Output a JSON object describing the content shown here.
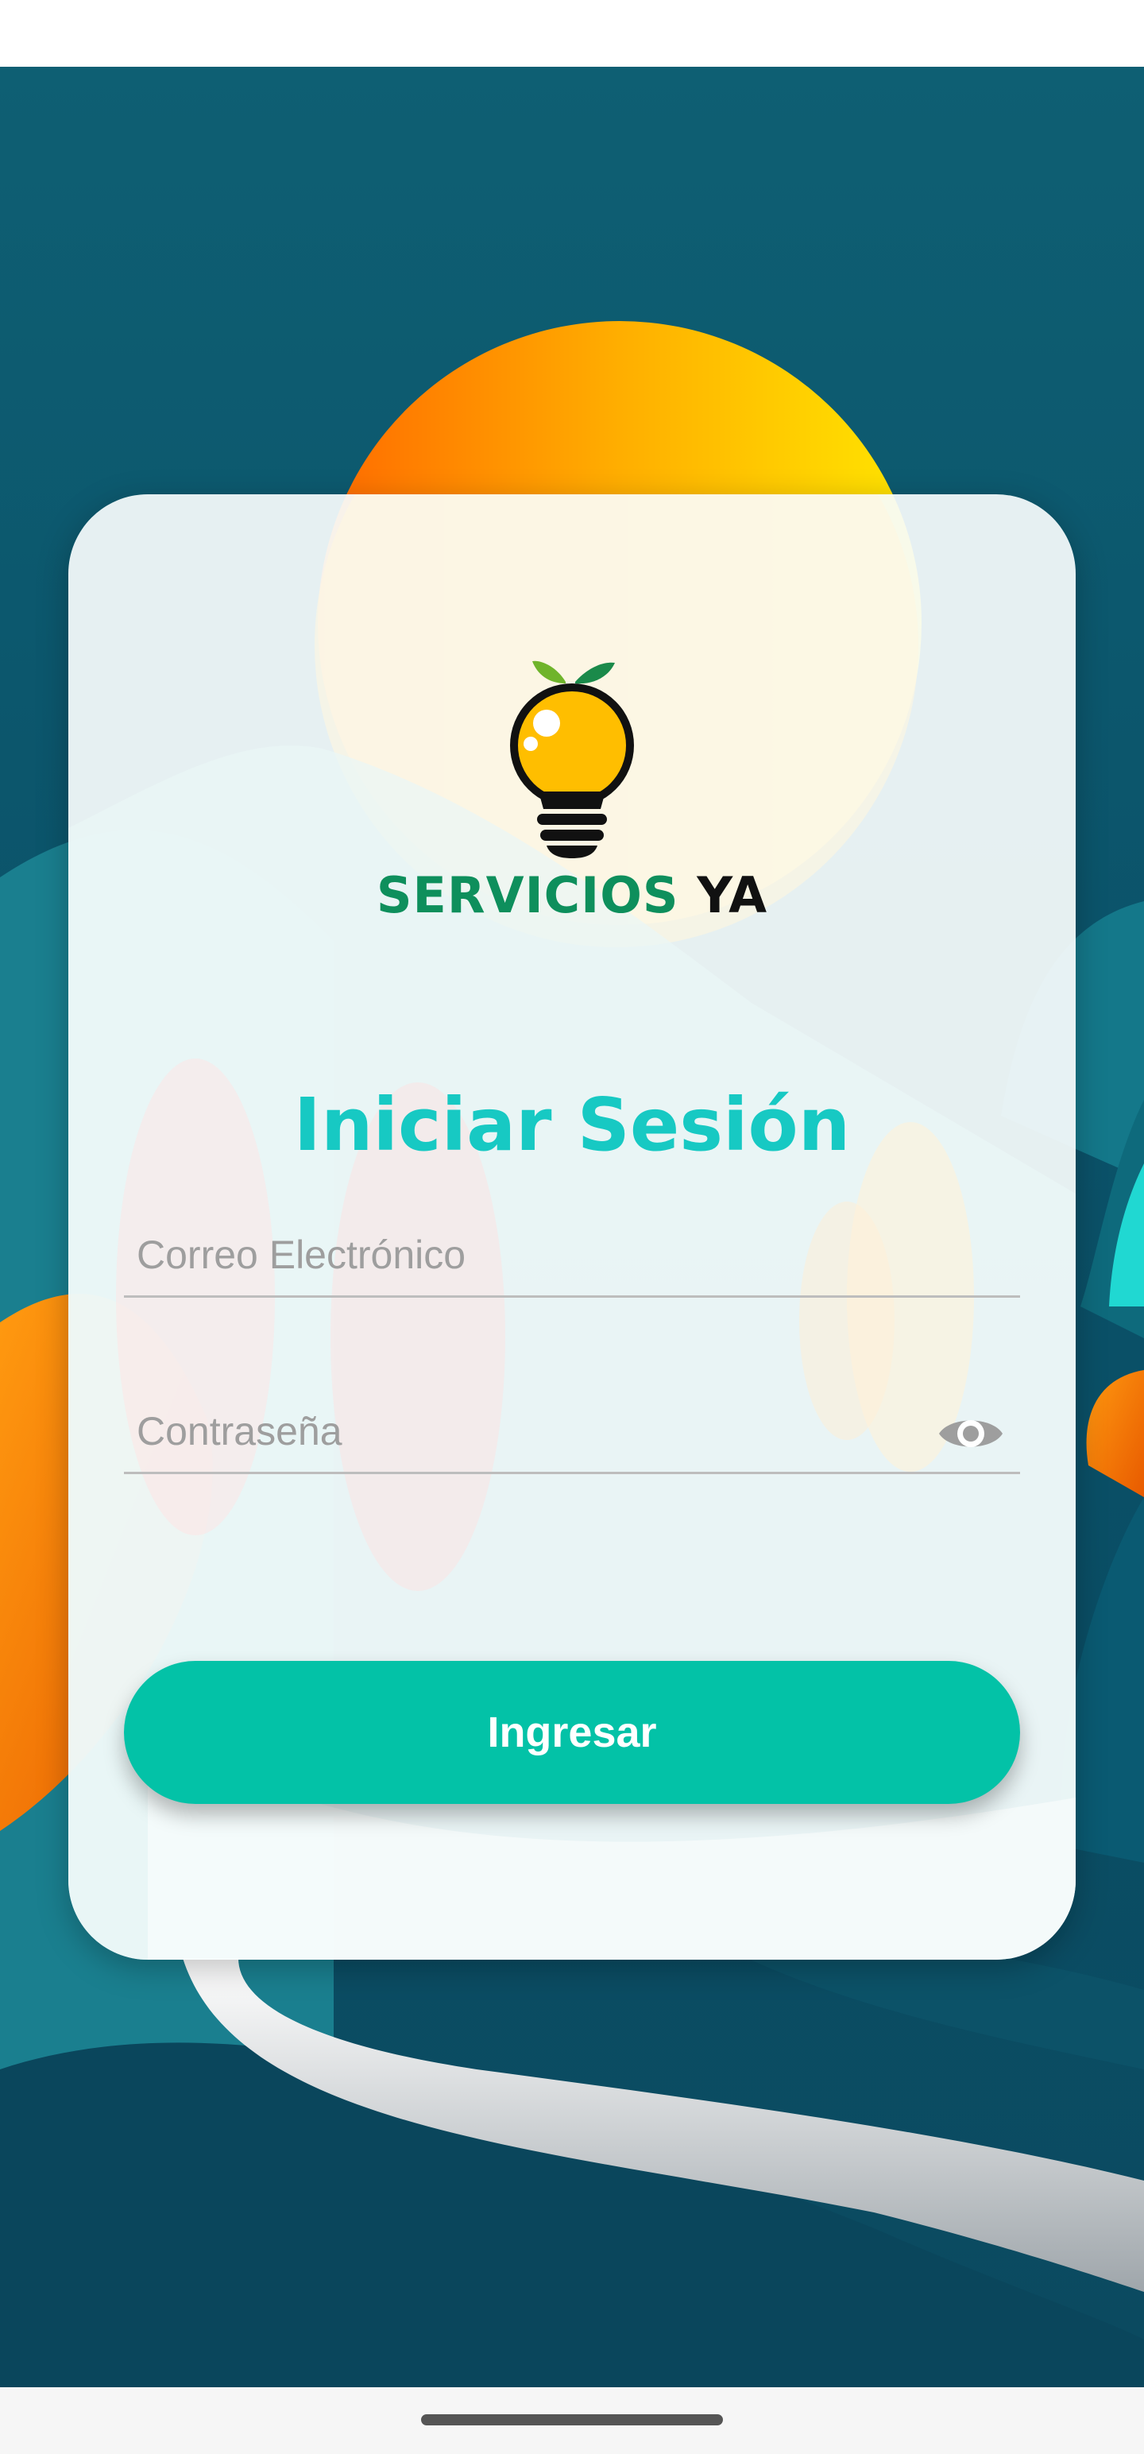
{
  "app": {
    "brand_primary": "SERVICIOS",
    "brand_secondary": "YA",
    "logo_icon": "lightbulb-icon"
  },
  "login": {
    "title": "Iniciar Sesión",
    "email_placeholder": "Correo Electrónico",
    "email_value": "",
    "password_placeholder": "Contraseña",
    "password_value": "",
    "toggle_visibility_icon": "eye-icon",
    "submit_label": "Ingresar"
  },
  "colors": {
    "accent": "#17c9c3",
    "button": "#03c2a7",
    "brand_green": "#0e8f5c",
    "background": "#0b536a"
  }
}
